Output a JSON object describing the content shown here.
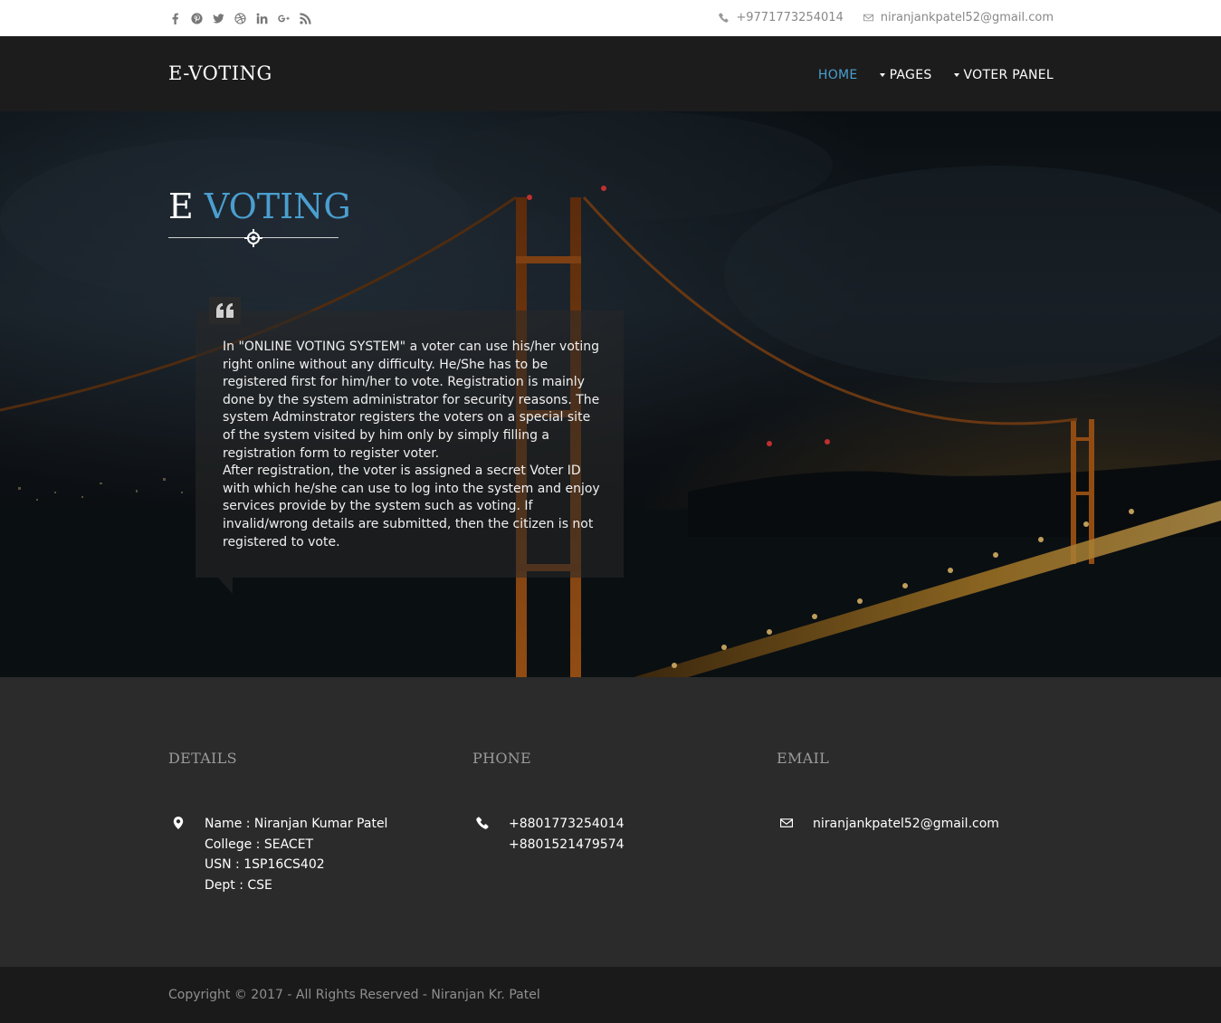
{
  "topbar": {
    "social_icons": [
      "facebook-icon",
      "pinterest-icon",
      "twitter-icon",
      "dribbble-icon",
      "linkedin-icon",
      "google-plus-icon",
      "rss-icon"
    ],
    "phone": "+9771773254014",
    "email": "niranjankpatel52@gmail.com"
  },
  "navbar": {
    "brand": "E-VOTING",
    "menu": [
      {
        "label": "HOME",
        "active": true
      },
      {
        "label": "PAGES",
        "dropdown": true
      },
      {
        "label": "VOTER PANEL",
        "dropdown": true
      }
    ]
  },
  "hero": {
    "title_plain": "E",
    "title_accent": "VOTING",
    "paragraph1": "In \"ONLINE VOTING SYSTEM\" a voter can use his/her voting right online without any difficulty. He/She has to be registered first for him/her to vote. Registration is mainly done by the system administrator for security reasons. The system Adminstrator registers the voters on a special site of the system visited by him only by simply filling a registration form to register voter.",
    "paragraph2": "After registration, the voter is assigned a secret Voter ID with which he/she can use to log into the system and enjoy services provide by the system such as voting. If invalid/wrong details are submitted, then the citizen is not registered to vote."
  },
  "info": {
    "details": {
      "heading": "DETAILS",
      "lines": [
        "Name : Niranjan Kumar Patel",
        "College : SEACET",
        "USN : 1SP16CS402",
        "Dept : CSE"
      ]
    },
    "phone": {
      "heading": "PHONE",
      "lines": [
        "+8801773254014",
        "+8801521479574"
      ]
    },
    "email": {
      "heading": "EMAIL",
      "lines": [
        "niranjankpatel52@gmail.com"
      ]
    }
  },
  "footer": {
    "copyright": "Copyright © 2017 - All Rights Reserved - Niranjan Kr. Patel"
  },
  "colors": {
    "accent": "#4a9fd0",
    "nav_bg": "#1c1c1c",
    "info_bg": "#2b2b2b",
    "footer_bg": "#1a1a1a"
  }
}
